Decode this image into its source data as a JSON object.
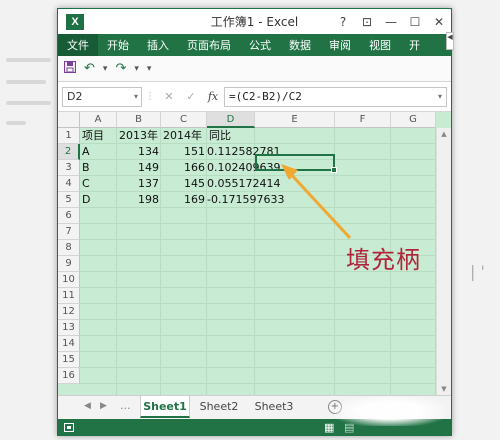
{
  "window": {
    "title": "工作簿1 - Excel",
    "logo_letter": "X",
    "controls": [
      "?",
      "⊡",
      "—",
      "☐",
      "✕"
    ]
  },
  "ribbon": {
    "tabs": [
      "文件",
      "开始",
      "插入",
      "页面布局",
      "公式",
      "数据",
      "审阅",
      "视图",
      "开"
    ],
    "active_index": 0,
    "scroll_glyph": "◀"
  },
  "quick_access": {
    "save": "save-icon",
    "undo": "↶",
    "redo": "↷",
    "more": "▾"
  },
  "formula_bar": {
    "name_box": "D2",
    "cancel": "✕",
    "enter": "✓",
    "fx": "fx",
    "formula": "=(C2-B2)/C2"
  },
  "sheet": {
    "columns": [
      "A",
      "B",
      "C",
      "D",
      "E",
      "F",
      "G"
    ],
    "selected_column": "D",
    "rows": [
      "1",
      "2",
      "3",
      "4",
      "5",
      "6",
      "7",
      "8",
      "9",
      "10",
      "11",
      "12",
      "13",
      "14",
      "15",
      "16"
    ],
    "selected_row": "2",
    "header": [
      "项目",
      "2013年",
      "2014年",
      "同比"
    ],
    "data": [
      [
        "A",
        "134",
        "151",
        "0.112582781"
      ],
      [
        "B",
        "149",
        "166",
        "0.102409639"
      ],
      [
        "C",
        "137",
        "145",
        "0.055172414"
      ],
      [
        "D",
        "198",
        "169",
        "-0.171597633"
      ]
    ],
    "active_cell": "D2"
  },
  "sheet_tabs": {
    "tabs": [
      "Sheet1",
      "Sheet2",
      "Sheet3"
    ],
    "active_index": 0,
    "nav_prev": "◀",
    "nav_next": "▶",
    "more": "...",
    "add": "+"
  },
  "annotation": {
    "label": "填充柄",
    "color": "#b1243a",
    "arrow_color": "#f0a830"
  },
  "colors": {
    "excel_green": "#217346",
    "grid_fill": "#c8ebd3"
  }
}
